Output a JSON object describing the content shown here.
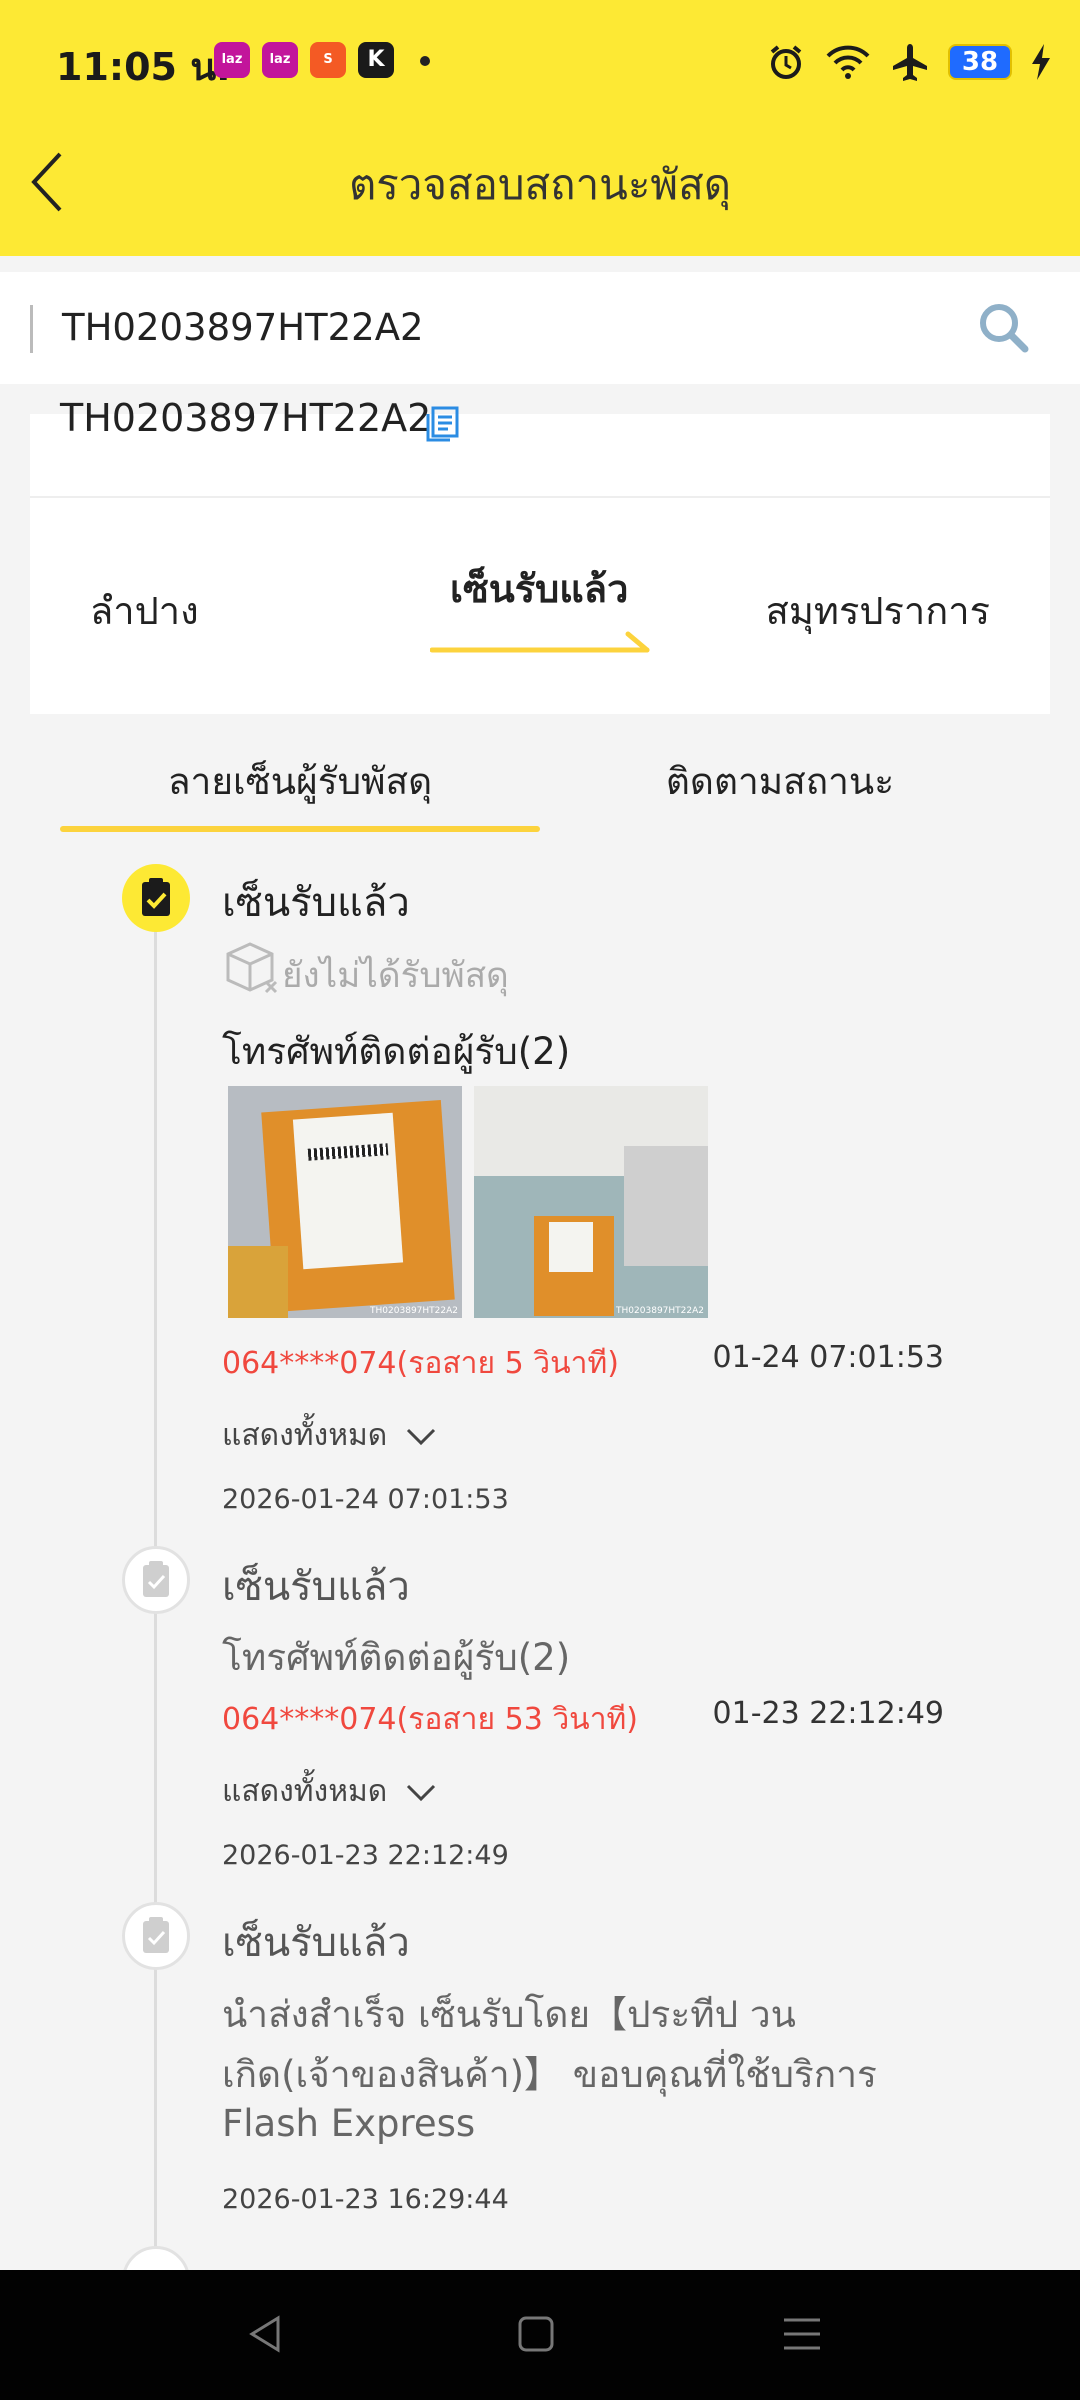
{
  "status_bar": {
    "time": "11:05 น.",
    "apps": [
      {
        "name": "lazada",
        "label": "laz",
        "color": "#c2159b"
      },
      {
        "name": "lazada",
        "label": "laz",
        "color": "#c2159b"
      },
      {
        "name": "shopee",
        "label": "S",
        "color": "#f45a24"
      },
      {
        "name": "kplus",
        "label": "K",
        "color": "#1a1a1a"
      }
    ],
    "battery": "38",
    "icons": [
      "alarm-icon",
      "wifi-icon",
      "airplane-icon",
      "charging-icon"
    ]
  },
  "header": {
    "title": "ตรวจสอบสถานะพัสดุ"
  },
  "search": {
    "value": "TH0203897HT22A2"
  },
  "card": {
    "tracking_number": "TH0203897HT22A2",
    "origin": "ลำปาง",
    "status": "เซ็นรับแล้ว",
    "destination": "สมุทรปราการ"
  },
  "tabs": [
    {
      "label": "ลายเซ็นผู้รับพัสดุ",
      "active": true
    },
    {
      "label": "ติดตามสถานะ",
      "active": false
    }
  ],
  "events": [
    {
      "title": "เซ็นรับแล้ว",
      "not_received": "ยังไม่ได้รับพัสดุ",
      "contact": "โทรศัพท์ติดต่อผู้รับ(2)",
      "call": "064****074(รอสาย 5 วินาที)",
      "call_time": "01-24 07:01:53",
      "show_all": "แสดงทั้งหมด",
      "timestamp": "2026-01-24 07:01:53"
    },
    {
      "title": "เซ็นรับแล้ว",
      "contact": "โทรศัพท์ติดต่อผู้รับ(2)",
      "call": "064****074(รอสาย 53 วินาที)",
      "call_time": "01-23 22:12:49",
      "show_all": "แสดงทั้งหมด",
      "timestamp": "2026-01-23 22:12:49"
    },
    {
      "title": "เซ็นรับแล้ว",
      "desc_line1": "นำส่งสำเร็จ เซ็นรับโดย【ประทีป วน",
      "desc_line2": "เกิด(เจ้าของสินค้า)】 ขอบคุณที่ใช้บริการ",
      "desc_line3": "Flash Express",
      "timestamp": "2026-01-23 16:29:44"
    }
  ],
  "photos": {
    "count": 2,
    "labels": [
      "TH0203897HT22A2",
      "TH0203897HT22A2"
    ]
  },
  "colors": {
    "brand_yellow": "#fde934",
    "accent_yellow": "#fcd33d",
    "red": "#f0483e",
    "link_blue": "#2b8ce3"
  }
}
